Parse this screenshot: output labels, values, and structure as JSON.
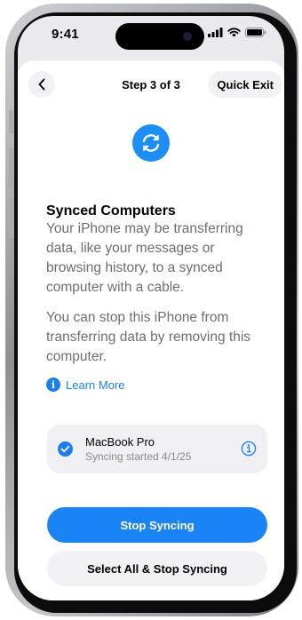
{
  "status_bar": {
    "time": "9:41",
    "icons": [
      "cellular-signal-icon",
      "wifi-icon",
      "battery-icon"
    ]
  },
  "nav": {
    "back_icon": "chevron-left-icon",
    "step_label": "Step 3 of 3",
    "quick_exit_label": "Quick Exit"
  },
  "hero_icon": "sync-arrows-icon",
  "content": {
    "title": "Synced Computers",
    "paragraph_1": "Your iPhone may be transferring data, like your messages or browsing history, to a synced computer with a cable.",
    "paragraph_2": "You can stop this iPhone from transferring data by removing this computer.",
    "learn_more_label": "Learn More"
  },
  "device": {
    "name": "MacBook Pro",
    "status": "Syncing started 4/1/25",
    "selected": true
  },
  "actions": {
    "primary_label": "Stop Syncing",
    "secondary_label": "Select All & Stop Syncing"
  },
  "colors": {
    "accent": "#1a84f6",
    "screen_background": "#e9e9ee",
    "sheet_background": "#ffffff",
    "secondary_text": "#6e6e73"
  }
}
